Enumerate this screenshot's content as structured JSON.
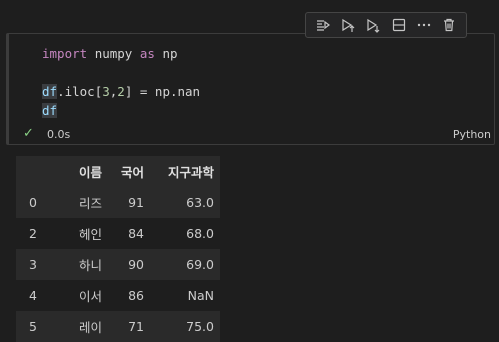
{
  "toolbar": {
    "icons": [
      "run-by-line-icon",
      "execute-above-icon",
      "execute-below-icon",
      "split-cell-icon",
      "more-icon",
      "delete-icon"
    ]
  },
  "cell": {
    "code": {
      "line1": {
        "kw1": "import",
        "mod": "numpy",
        "kw2": "as",
        "alias": "np"
      },
      "line2": {
        "obj": "df",
        "rest1": ".iloc[",
        "n1": "3",
        "comma": ",",
        "n2": "2",
        "rest2": "] = ",
        "np": "np",
        "attr": ".nan"
      },
      "line3": {
        "obj": "df"
      }
    },
    "status": {
      "duration": "0.0s",
      "language": "Python"
    }
  },
  "dataframe": {
    "columns": [
      "",
      "이름",
      "국어",
      "지구과학"
    ],
    "rows": [
      [
        "0",
        "리즈",
        "91",
        "63.0"
      ],
      [
        "2",
        "헤인",
        "84",
        "68.0"
      ],
      [
        "3",
        "하니",
        "90",
        "69.0"
      ],
      [
        "4",
        "이서",
        "86",
        "NaN"
      ],
      [
        "5",
        "레이",
        "71",
        "75.0"
      ]
    ]
  }
}
